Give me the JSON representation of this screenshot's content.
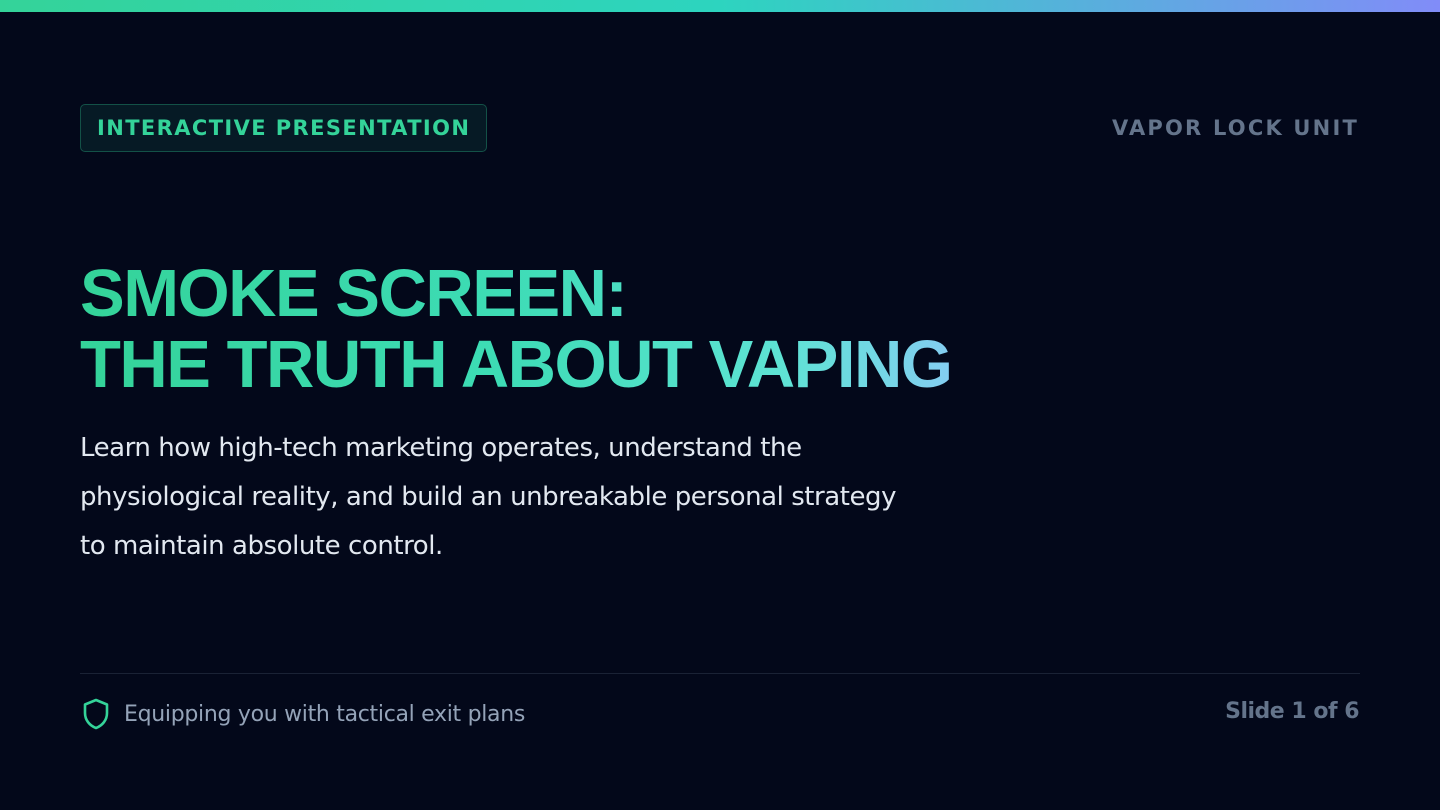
{
  "header": {
    "badge_label": "INTERACTIVE PRESENTATION",
    "unit_label": "VAPOR LOCK UNIT"
  },
  "main": {
    "title_line1": "SMOKE SCREEN:",
    "title_line2": "THE TRUTH ABOUT VAPING",
    "subtitle": "Learn how high-tech marketing operates, understand the physiological reality, and build an unbreakable personal strategy to maintain absolute control."
  },
  "footer": {
    "icon": "shield-icon",
    "tagline": "Equipping you with tactical exit plans",
    "slide_counter": "Slide 1 of 6"
  },
  "colors": {
    "background": "#03081a",
    "accent_green": "#34d399",
    "accent_teal": "#2dd4bf",
    "accent_blue": "#93c5fd",
    "accent_indigo": "#818cf8",
    "text_primary": "#e2e8f0",
    "text_muted": "#64748b"
  }
}
